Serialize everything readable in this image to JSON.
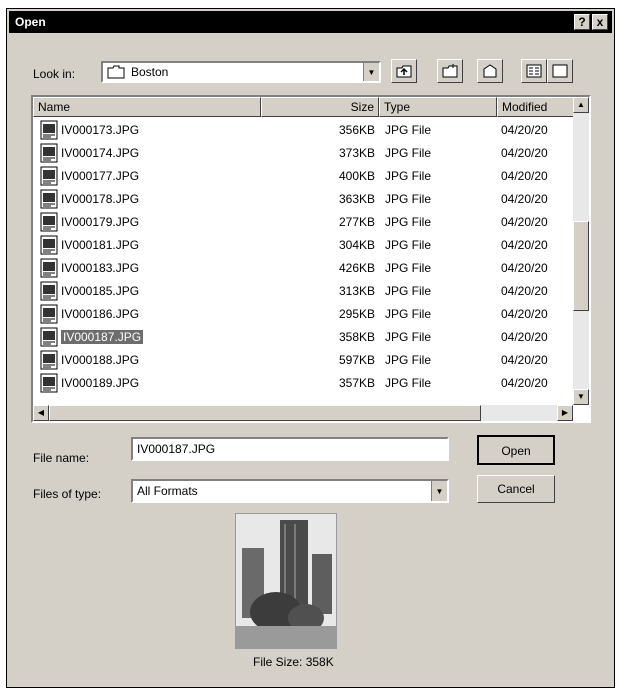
{
  "window": {
    "title": "Open"
  },
  "titlebar": {
    "help_label": "?",
    "close_label": "x"
  },
  "look_in": {
    "label": "Look in:",
    "value": "Boston"
  },
  "columns": {
    "name": "Name",
    "size": "Size",
    "type": "Type",
    "modified": "Modified"
  },
  "files": [
    {
      "name": "IV000173.JPG",
      "size": "356KB",
      "type": "JPG File",
      "modified": "04/20/20"
    },
    {
      "name": "IV000174.JPG",
      "size": "373KB",
      "type": "JPG File",
      "modified": "04/20/20"
    },
    {
      "name": "IV000177.JPG",
      "size": "400KB",
      "type": "JPG File",
      "modified": "04/20/20"
    },
    {
      "name": "IV000178.JPG",
      "size": "363KB",
      "type": "JPG File",
      "modified": "04/20/20"
    },
    {
      "name": "IV000179.JPG",
      "size": "277KB",
      "type": "JPG File",
      "modified": "04/20/20"
    },
    {
      "name": "IV000181.JPG",
      "size": "304KB",
      "type": "JPG File",
      "modified": "04/20/20"
    },
    {
      "name": "IV000183.JPG",
      "size": "426KB",
      "type": "JPG File",
      "modified": "04/20/20"
    },
    {
      "name": "IV000185.JPG",
      "size": "313KB",
      "type": "JPG File",
      "modified": "04/20/20"
    },
    {
      "name": "IV000186.JPG",
      "size": "295KB",
      "type": "JPG File",
      "modified": "04/20/20"
    },
    {
      "name": "IV000187.JPG",
      "size": "358KB",
      "type": "JPG File",
      "modified": "04/20/20",
      "selected": true
    },
    {
      "name": "IV000188.JPG",
      "size": "597KB",
      "type": "JPG File",
      "modified": "04/20/20"
    },
    {
      "name": "IV000189.JPG",
      "size": "357KB",
      "type": "JPG File",
      "modified": "04/20/20"
    }
  ],
  "file_name": {
    "label": "File name:",
    "value": "IV000187.JPG"
  },
  "file_type": {
    "label": "Files of type:",
    "value": "All Formats"
  },
  "buttons": {
    "open": "Open",
    "cancel": "Cancel"
  },
  "preview": {
    "file_size_label": "File Size:",
    "file_size_value": "358K"
  },
  "icons": {
    "folder": "folder-icon",
    "up": "up-folder-icon",
    "new_folder": "new-folder-icon",
    "desktop": "desktop-icon",
    "list_view": "list-view-icon",
    "details_view": "details-view-icon",
    "file": "jpg-file-icon"
  }
}
